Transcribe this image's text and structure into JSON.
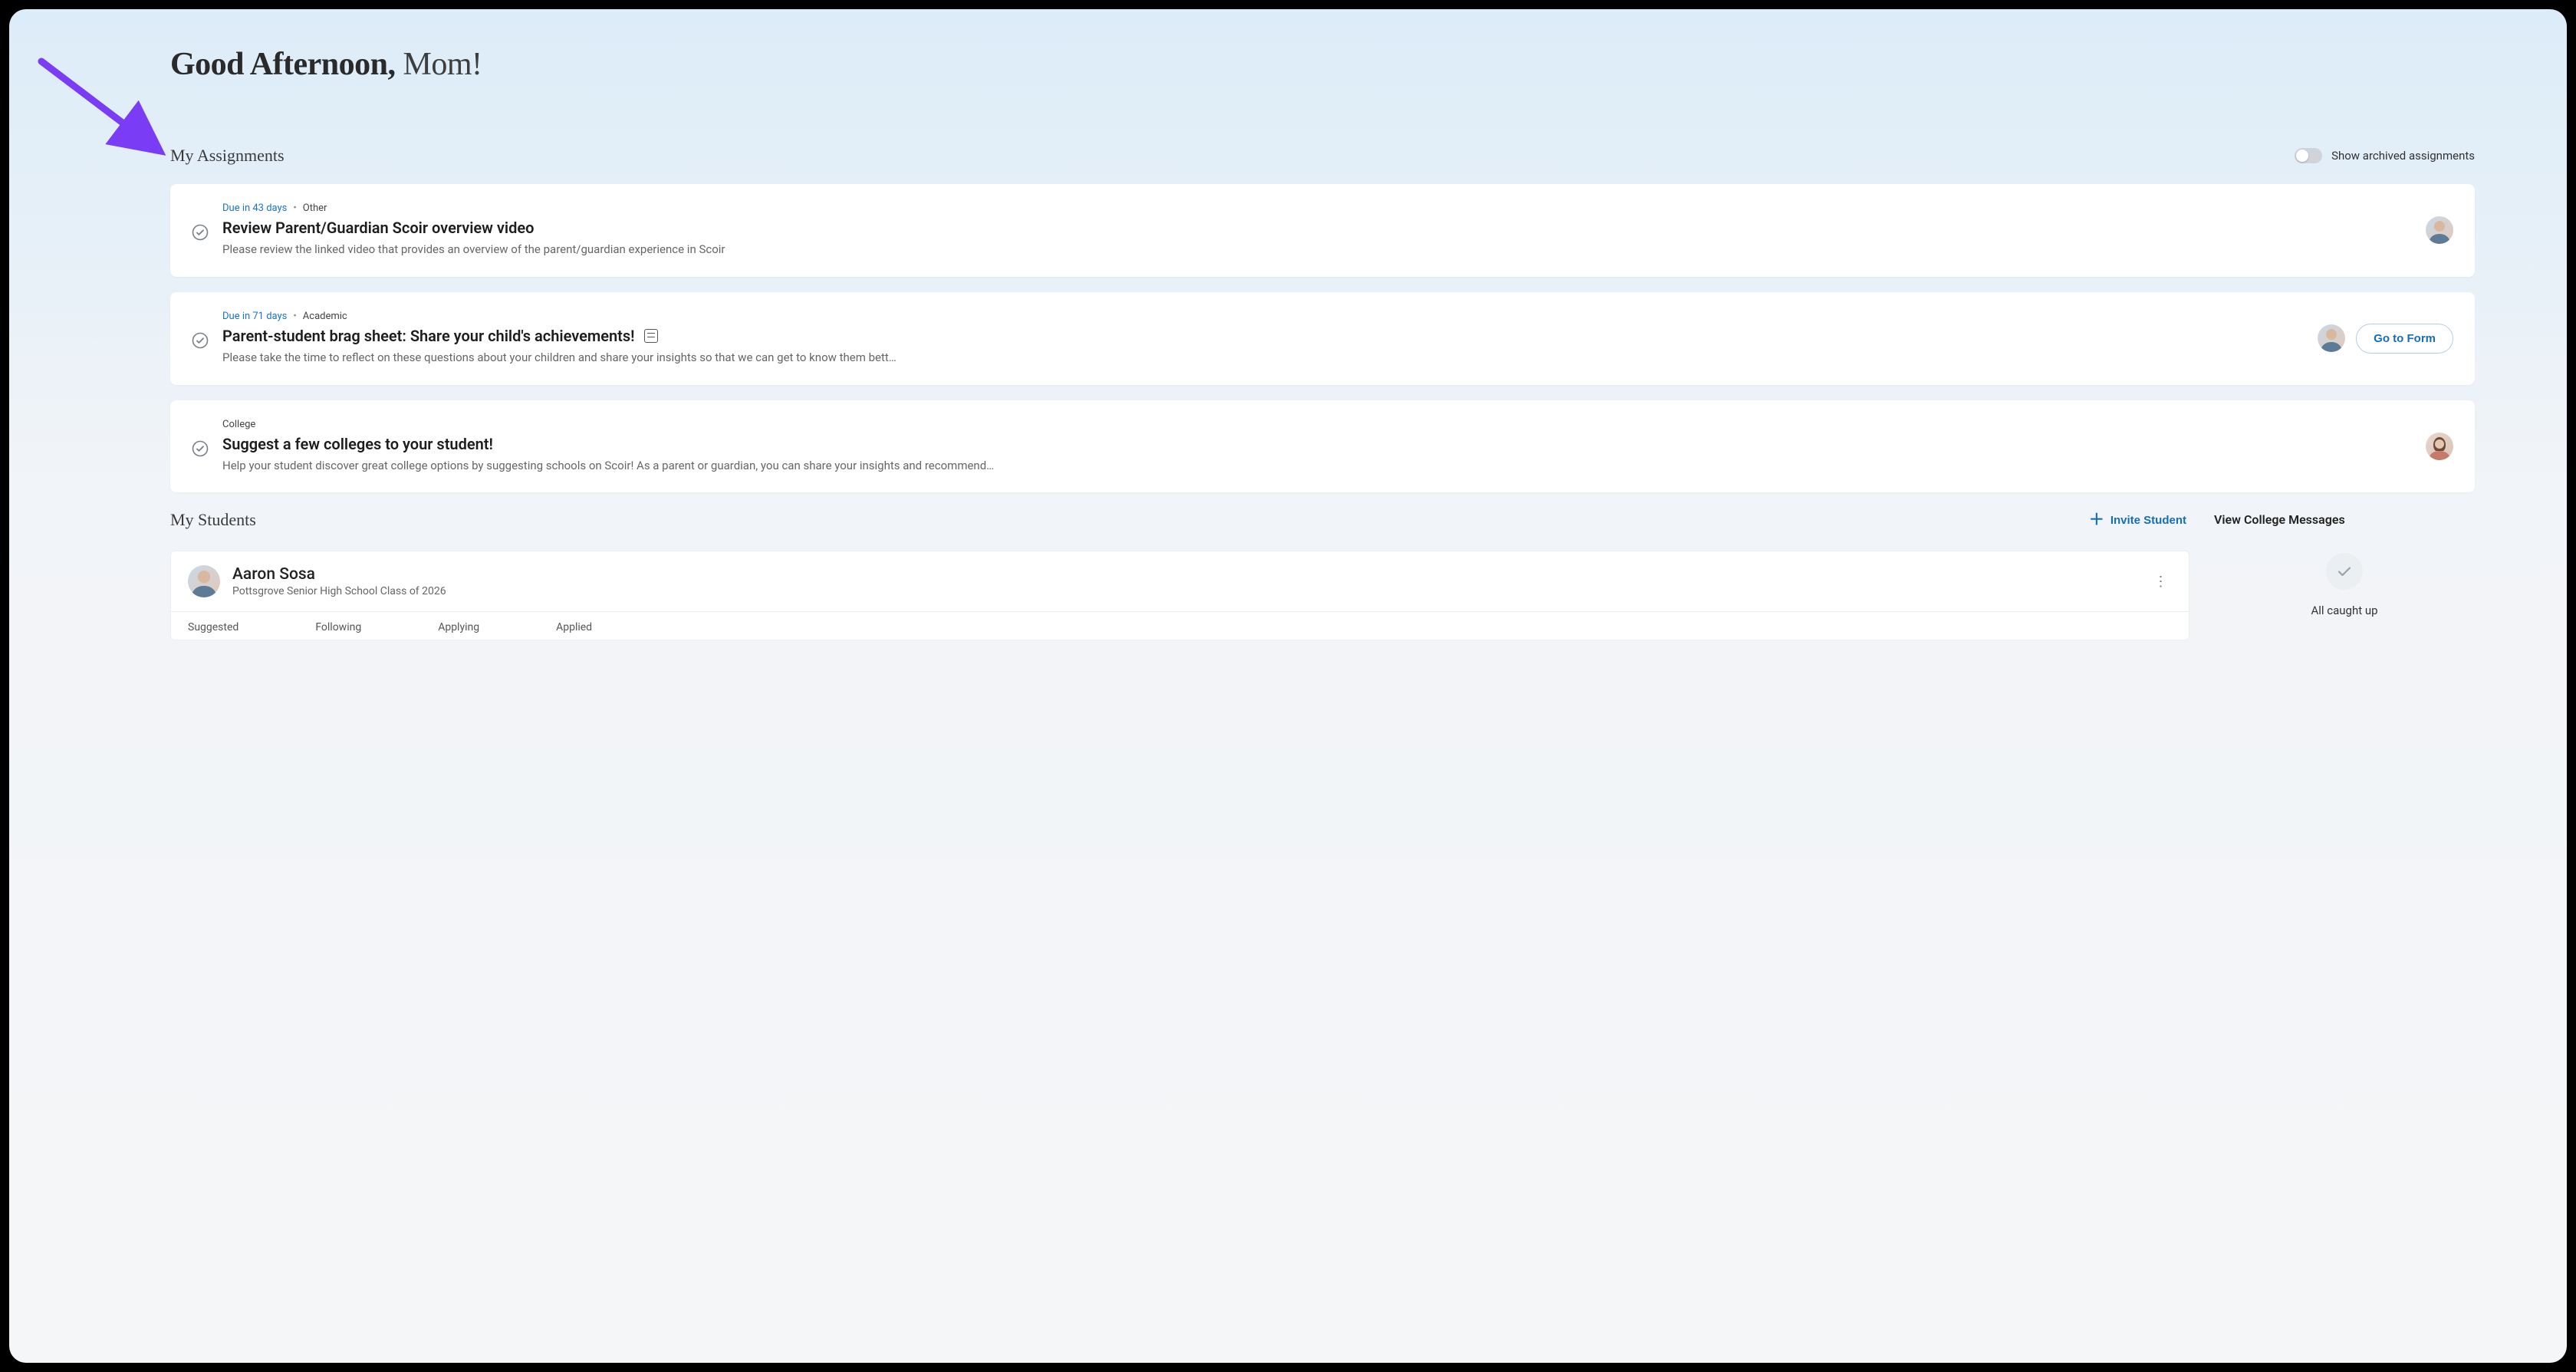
{
  "greeting": {
    "prefix": "Good Afternoon,",
    "name": "Mom",
    "suffix": "!"
  },
  "assignments": {
    "title": "My Assignments",
    "toggleLabel": "Show archived assignments",
    "items": [
      {
        "due": "Due in 43 days",
        "category": "Other",
        "title": "Review Parent/Guardian Scoir overview video",
        "desc": "Please review the linked video that provides an overview of the parent/guardian experience in Scoir",
        "hasForm": false,
        "action": null,
        "avatarType": "m"
      },
      {
        "due": "Due in 71 days",
        "category": "Academic",
        "title": "Parent-student brag sheet: Share your child's achievements!",
        "desc": "Please take the time to reflect on these questions about your children and share your insights so that we can get to know them bett…",
        "hasForm": true,
        "action": "Go to Form",
        "avatarType": "m"
      },
      {
        "due": null,
        "category": "College",
        "title": "Suggest a few colleges to your student!",
        "desc": "Help your student discover great college options by suggesting schools on Scoir! As a parent or guardian, you can share your insights and recommend…",
        "hasForm": false,
        "action": null,
        "avatarType": "f"
      }
    ]
  },
  "students": {
    "title": "My Students",
    "inviteLabel": "Invite Student",
    "list": [
      {
        "name": "Aaron Sosa",
        "subtitle": "Pottsgrove Senior High School Class of 2026",
        "tabs": [
          "Suggested",
          "Following",
          "Applying",
          "Applied"
        ]
      }
    ]
  },
  "messages": {
    "title": "View College Messages",
    "emptyText": "All caught up"
  }
}
